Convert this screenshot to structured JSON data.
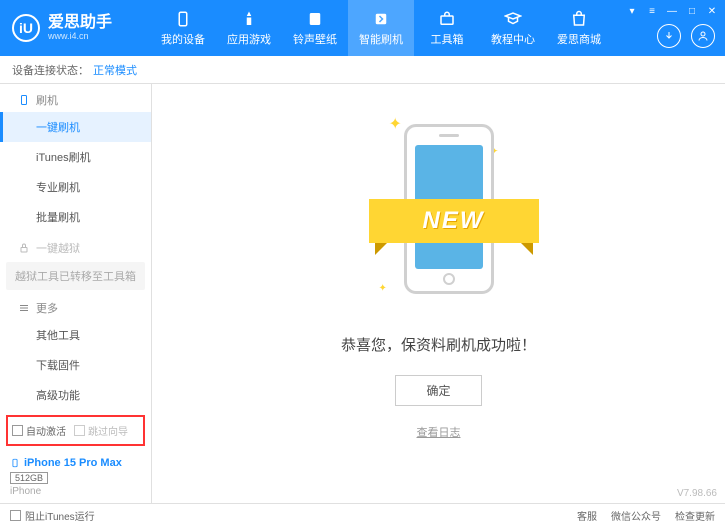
{
  "app": {
    "name": "爱思助手",
    "url": "www.i4.cn",
    "logo_letter": "iU"
  },
  "nav": [
    {
      "label": "我的设备"
    },
    {
      "label": "应用游戏"
    },
    {
      "label": "铃声壁纸"
    },
    {
      "label": "智能刷机"
    },
    {
      "label": "工具箱"
    },
    {
      "label": "教程中心"
    },
    {
      "label": "爱思商城"
    }
  ],
  "status": {
    "label": "设备连接状态：",
    "value": "正常模式"
  },
  "sidebar": {
    "flash_section": "刷机",
    "items": {
      "oneclick": "一键刷机",
      "itunes": "iTunes刷机",
      "pro": "专业刷机",
      "batch": "批量刷机"
    },
    "jailbreak_section": "一键越狱",
    "jailbreak_moved": "越狱工具已转移至工具箱",
    "more_section": "更多",
    "more": {
      "other": "其他工具",
      "download": "下载固件",
      "advanced": "高级功能"
    },
    "checkboxes": {
      "auto_activate": "自动激活",
      "skip_guide": "跳过向导"
    }
  },
  "device": {
    "name": "iPhone 15 Pro Max",
    "storage": "512GB",
    "type": "iPhone"
  },
  "main": {
    "new_badge": "NEW",
    "success": "恭喜您，保资料刷机成功啦！",
    "ok": "确定",
    "view_log": "查看日志"
  },
  "footer": {
    "block_itunes": "阻止iTunes运行",
    "version": "V7.98.66",
    "links": {
      "service": "客服",
      "wechat": "微信公众号",
      "update": "检查更新"
    }
  }
}
